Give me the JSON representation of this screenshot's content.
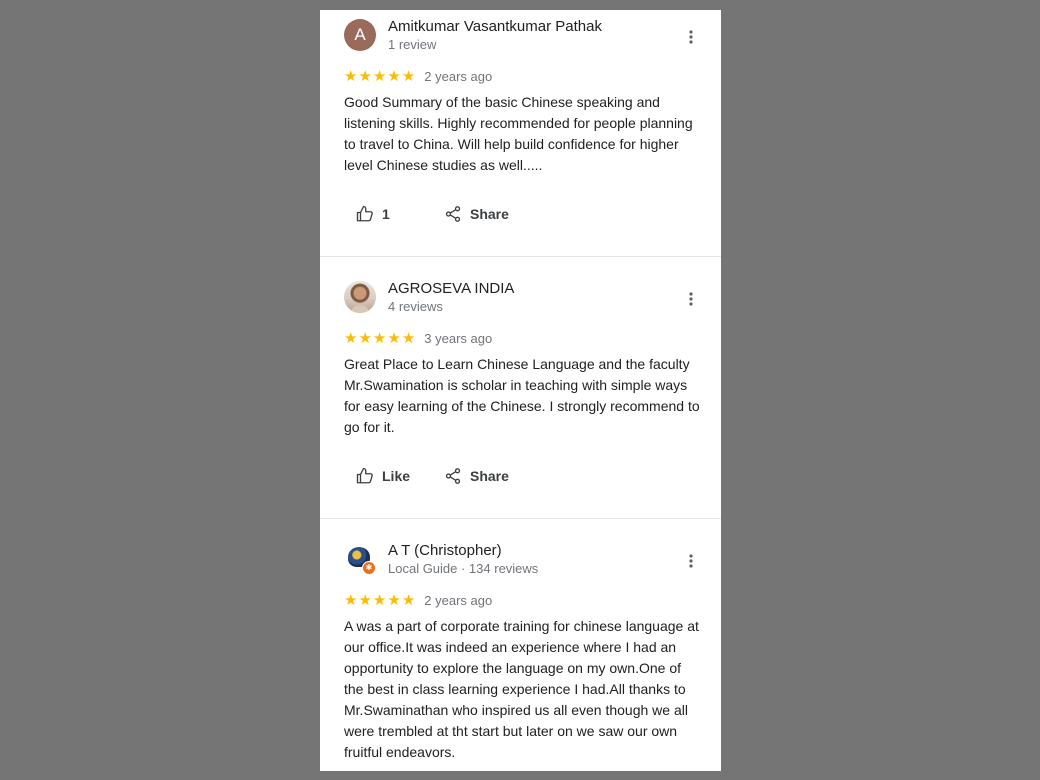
{
  "reviews": [
    {
      "avatar": {
        "type": "letter",
        "letter": "A",
        "color": "#9a6b5a"
      },
      "name": "Amitkumar Vasantkumar Pathak",
      "meta": "1 review",
      "stars": 5,
      "age": "2 years ago",
      "text": "Good Summary of the basic Chinese speaking and listening skills. Highly recommended for people planning to travel to China. Will help build confidence for higher level Chinese studies as well.....",
      "like_label": "1",
      "share_label": "Share"
    },
    {
      "avatar": {
        "type": "photo",
        "icon": "person-photo"
      },
      "name": "AGROSEVA INDIA",
      "meta": "4 reviews",
      "stars": 5,
      "age": "3 years ago",
      "text": "Great Place to Learn Chinese Language and the faculty Mr.Swamination is scholar in teaching with simple ways for easy learning of the Chinese. I strongly recommend to go for it.",
      "like_label": "Like",
      "share_label": "Share"
    },
    {
      "avatar": {
        "type": "photo",
        "icon": "helmet-photo",
        "badge": "local-guide-badge"
      },
      "name": "A T (Christopher)",
      "meta": "Local Guide · 134 reviews",
      "stars": 5,
      "age": "2 years ago",
      "text": "A was a part of corporate training for chinese language at our office.It was indeed an experience where I had an opportunity to explore the language on my own.One of the best in class learning experience I had.All thanks to Mr.Swaminathan who inspired us all even though we all were trembled at tht start but later on we saw our own fruitful endeavors."
    }
  ],
  "colors": {
    "background": "#757575",
    "star": "#fbbc04",
    "name": "#202124",
    "meta": "#70757a"
  }
}
